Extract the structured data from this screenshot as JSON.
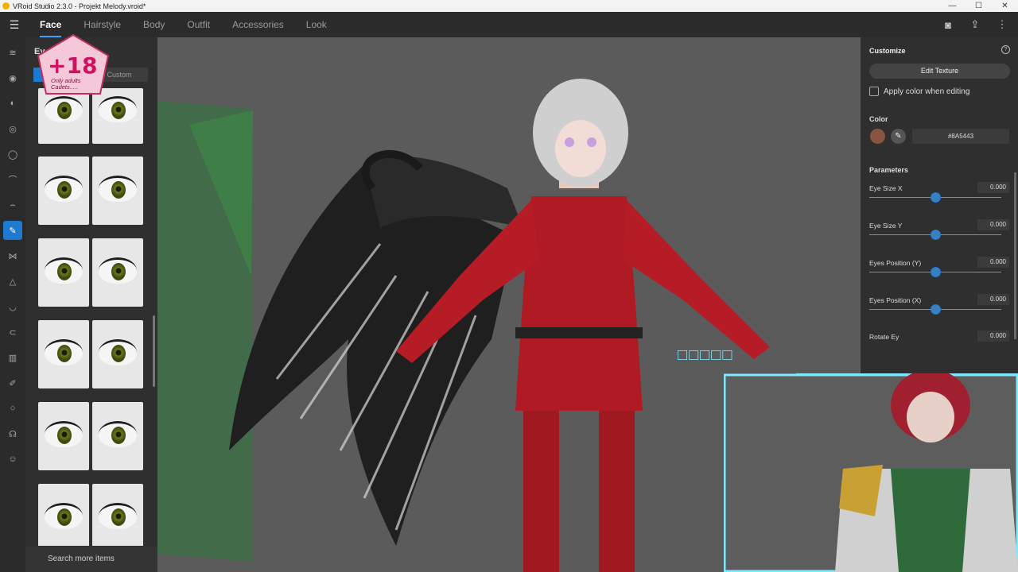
{
  "window": {
    "title": "VRoid Studio 2.3.0 - Projekt Melody.vroid*",
    "controls": [
      "—",
      "☐",
      "✕"
    ]
  },
  "topnav": {
    "tabs": [
      {
        "label": "Face",
        "active": true
      },
      {
        "label": "Hairstyle",
        "active": false
      },
      {
        "label": "Body",
        "active": false
      },
      {
        "label": "Outfit",
        "active": false
      },
      {
        "label": "Accessories",
        "active": false
      },
      {
        "label": "Look",
        "active": false
      }
    ],
    "right_icons": [
      "camera-icon",
      "share-icon",
      "more-vertical-icon"
    ]
  },
  "rail": {
    "icons": [
      "face-preset-icon",
      "eye-icon",
      "nose-icon",
      "eye-alt-icon",
      "mouth-icon",
      "eyebrow-icon",
      "eyelash-icon",
      "brush-icon",
      "whisker-icon",
      "nose-bridge-icon",
      "mouth-line-icon",
      "ear-icon",
      "chart-icon",
      "pen-icon",
      "circle-icon",
      "head-icon",
      "face-smile-icon"
    ]
  },
  "itempanel": {
    "header": "Ey",
    "segment": {
      "left": "",
      "right": "Custom"
    },
    "search_more": "Search more items"
  },
  "overlay": {
    "badge_text": "+18",
    "badge_sub_1": "Only adults",
    "badge_sub_2": "Cadets....."
  },
  "rightpanel": {
    "title": "Customize",
    "edit_texture": "Edit Texture",
    "apply_color": "Apply color when editing",
    "color_label": "Color",
    "color_hex": "#8A5443",
    "colors": {
      "swatch": "#8A5443",
      "accent": "#1e7ad0"
    },
    "parameters_label": "Parameters",
    "params": [
      {
        "name": "Eye Size X",
        "value": "0.000",
        "level": 0.5
      },
      {
        "name": "Eye Size Y",
        "value": "0.000",
        "level": 0.5
      },
      {
        "name": "Eyes Position (Y)",
        "value": "0.000",
        "level": 0.5
      },
      {
        "name": "Eyes Position (X)",
        "value": "0.000",
        "level": 0.5
      },
      {
        "name": "Rotate Ey",
        "value": "0.000",
        "level": 0.5
      }
    ]
  }
}
